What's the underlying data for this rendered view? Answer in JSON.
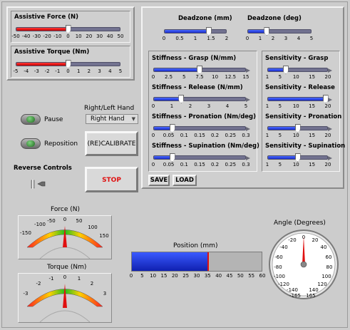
{
  "assistive": {
    "force": {
      "label": "Assistive Force (N)",
      "ticks": [
        "-50",
        "-40",
        "-30",
        "-20",
        "-10",
        "0",
        "10",
        "20",
        "30",
        "40",
        "50"
      ],
      "value_fraction": 0.5
    },
    "torque": {
      "label": "Assistive Torque (Nm)",
      "ticks": [
        "-5",
        "-4",
        "-3",
        "-2",
        "-1",
        "0",
        "1",
        "2",
        "3",
        "4",
        "5"
      ],
      "value_fraction": 0.5
    }
  },
  "deadzone": {
    "mm": {
      "label": "Deadzone (mm)",
      "ticks": [
        "0",
        "0.5",
        "1",
        "1.5",
        "2"
      ],
      "value_fraction": 0.72
    },
    "deg": {
      "label": "Deadzone (deg)",
      "ticks": [
        "0",
        "1",
        "2",
        "3",
        "4",
        "5"
      ],
      "value_fraction": 0.3
    }
  },
  "stiffness": [
    {
      "label": "Stiffness - Grasp  (N/mm)",
      "ticks": [
        "0",
        "2.5",
        "5",
        "7.5",
        "10",
        "12.5",
        "15"
      ],
      "value_fraction": 0.5
    },
    {
      "label": "Stiffness - Release (N/mm)",
      "ticks": [
        "0",
        "1",
        "2",
        "3",
        "4",
        "5"
      ],
      "value_fraction": 0.3
    },
    {
      "label": "Stiffness - Pronation (Nm/deg)",
      "ticks": [
        "0",
        "0.05",
        "0.1",
        "0.15",
        "0.2",
        "0.25",
        "0.3"
      ],
      "value_fraction": 0.2
    },
    {
      "label": "Stiffness - Supination (Nm/deg)",
      "ticks": [
        "0",
        "0.05",
        "0.1",
        "0.15",
        "0.2",
        "0.25",
        "0.3"
      ],
      "value_fraction": 0.2
    }
  ],
  "sensitivity": [
    {
      "label": "Sensitivity - Grasp",
      "ticks": [
        "1",
        "5",
        "10",
        "15",
        "20"
      ],
      "value_fraction": 0.3
    },
    {
      "label": "Sensitivity - Release",
      "ticks": [
        "1",
        "5",
        "10",
        "15",
        "20"
      ],
      "value_fraction": 0.97
    },
    {
      "label": "Sensitivity - Pronation",
      "ticks": [
        "1",
        "5",
        "10",
        "15",
        "20"
      ],
      "value_fraction": 0.5
    },
    {
      "label": "Sensitivity - Supination",
      "ticks": [
        "1",
        "5",
        "10",
        "15",
        "20"
      ],
      "value_fraction": 0.5
    }
  ],
  "controls": {
    "pause_label": "Pause",
    "reposition_label": "Reposition",
    "hand_label": "Right/Left Hand",
    "hand_value": "Right Hand",
    "calibrate_label": "(RE)CALIBRATE",
    "reverse_label": "Reverse Controls",
    "stop_label": "STOP",
    "save_label": "SAVE",
    "load_label": "LOAD",
    "led_color": "#2e8b2e",
    "stop_color": "#e01010"
  },
  "gauges": {
    "force": {
      "label": "Force (N)",
      "ticks": [
        "-150",
        "-100",
        "-50",
        "0",
        "50",
        "100",
        "150"
      ],
      "value": 0
    },
    "torque": {
      "label": "Torque (Nm)",
      "ticks": [
        "-3",
        "-2",
        "-1",
        "0",
        "1",
        "2",
        "3"
      ],
      "value": 0
    }
  },
  "position": {
    "label": "Position (mm)",
    "ticks": [
      "0",
      "5",
      "10",
      "15",
      "20",
      "25",
      "30",
      "35",
      "40",
      "45",
      "50",
      "55",
      "60"
    ],
    "value": 35,
    "max": 60
  },
  "angle": {
    "label": "Angle (Degrees)",
    "ticks": [
      "0",
      "20",
      "40",
      "60",
      "80",
      "100",
      "120",
      "140",
      "165",
      "-165",
      "-140",
      "-120",
      "-100",
      "-80",
      "-60",
      "-40",
      "-20"
    ],
    "value": 0
  }
}
